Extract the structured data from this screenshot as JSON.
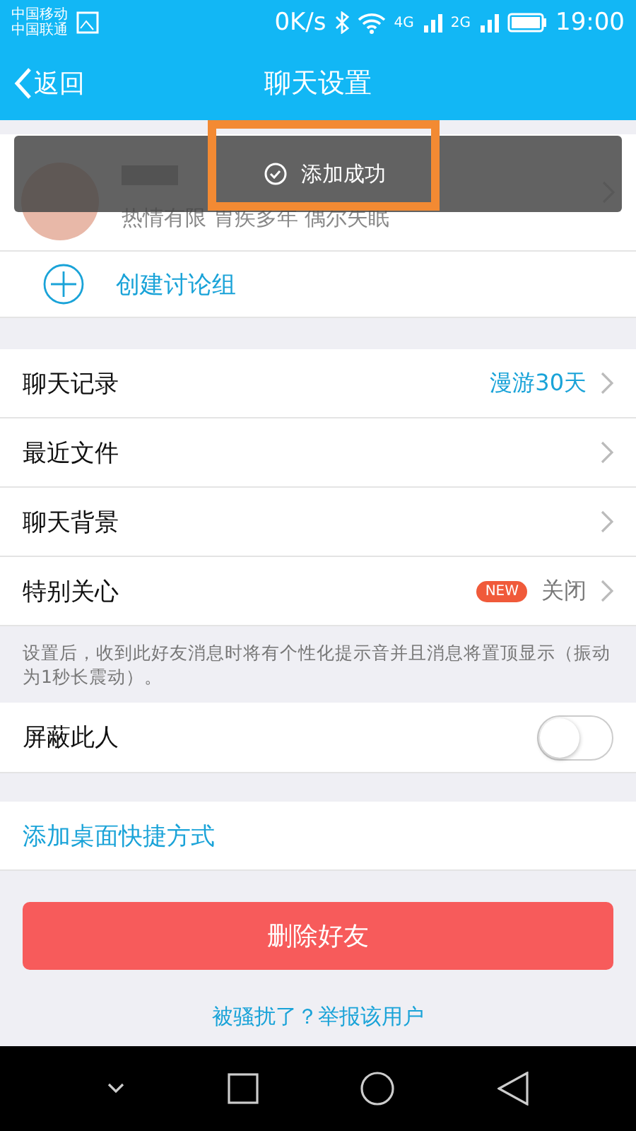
{
  "status_bar": {
    "carriers": [
      "中国移动",
      "中国联通"
    ],
    "speed": "0K/s",
    "network_1": "4G",
    "network_2": "2G",
    "time": "19:00"
  },
  "nav": {
    "back": "返回",
    "title": "聊天设置"
  },
  "toast": {
    "text": "添加成功",
    "highlighted": true
  },
  "profile": {
    "signature": "热情有限 胃疾多年 偶尔失眠"
  },
  "create_group": "创建讨论组",
  "settings": [
    {
      "label": "聊天记录",
      "value": "漫游30天",
      "value_highlighted": true
    },
    {
      "label": "最近文件"
    },
    {
      "label": "聊天背景"
    },
    {
      "label": "特别关心",
      "badge": "NEW",
      "value": "关闭",
      "value_highlighted": false
    }
  ],
  "note": "设置后，收到此好友消息时将有个性化提示音并且消息将置顶显示（振动为1秒长震动）。",
  "block": {
    "label": "屏蔽此人",
    "on": false
  },
  "shortcut": "添加桌面快捷方式",
  "delete_button": "删除好友",
  "report_link": "被骚扰了？举报该用户"
}
